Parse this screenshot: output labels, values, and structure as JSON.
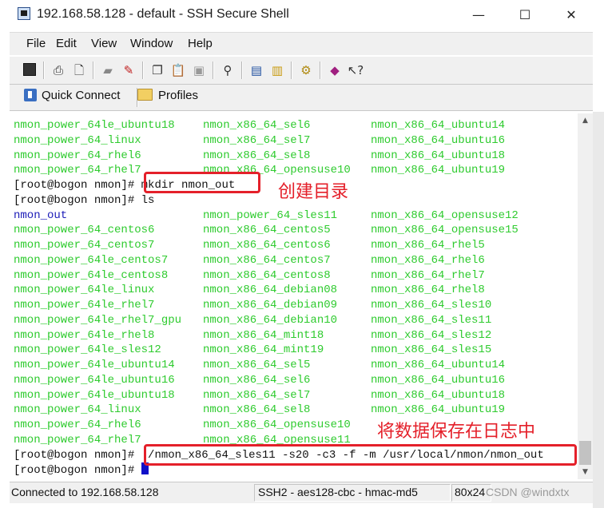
{
  "window": {
    "title": "192.168.58.128 - default - SSH Secure Shell",
    "minimize_icon": "minimize-icon",
    "maximize_icon": "maximize-icon",
    "close_icon": "close-icon"
  },
  "menu": [
    "File",
    "Edit",
    "View",
    "Window",
    "Help"
  ],
  "toolbar": {
    "icons": [
      "save-icon",
      "print-icon",
      "print-preview-icon",
      "copy-icon",
      "paste-icon",
      "paste-disabled-icon",
      "find-icon",
      "new-terminal-icon",
      "new-file-transfer-icon",
      "settings-icon",
      "help-topics-icon",
      "context-help-icon"
    ]
  },
  "toolbar2": {
    "quick_connect": "Quick Connect",
    "profiles": "Profiles"
  },
  "terminal": {
    "lines": [
      [
        "nmon_power_64le_ubuntu18",
        "nmon_x86_64_sel6",
        "nmon_x86_64_ubuntu14"
      ],
      [
        "nmon_power_64_linux",
        "nmon_x86_64_sel7",
        "nmon_x86_64_ubuntu16"
      ],
      [
        "nmon_power_64_rhel6",
        "nmon_x86_64_sel8",
        "nmon_x86_64_ubuntu18"
      ],
      [
        "nmon_power_64_rhel7",
        "nmon_x86_64_opensuse10",
        "nmon_x86_64_ubuntu19"
      ]
    ],
    "prompt": "[root@bogon nmon]# ",
    "cmd_mkdir": "mkdir nmon_out",
    "cmd_ls": "ls",
    "ls_rows": [
      [
        "nmon_out",
        "nmon_power_64_sles11",
        "nmon_x86_64_opensuse12"
      ],
      [
        "nmon_power_64_centos6",
        "nmon_x86_64_centos5",
        "nmon_x86_64_opensuse15"
      ],
      [
        "nmon_power_64_centos7",
        "nmon_x86_64_centos6",
        "nmon_x86_64_rhel5"
      ],
      [
        "nmon_power_64le_centos7",
        "nmon_x86_64_centos7",
        "nmon_x86_64_rhel6"
      ],
      [
        "nmon_power_64le_centos8",
        "nmon_x86_64_centos8",
        "nmon_x86_64_rhel7"
      ],
      [
        "nmon_power_64le_linux",
        "nmon_x86_64_debian08",
        "nmon_x86_64_rhel8"
      ],
      [
        "nmon_power_64le_rhel7",
        "nmon_x86_64_debian09",
        "nmon_x86_64_sles10"
      ],
      [
        "nmon_power_64le_rhel7_gpu",
        "nmon_x86_64_debian10",
        "nmon_x86_64_sles11"
      ],
      [
        "nmon_power_64le_rhel8",
        "nmon_x86_64_mint18",
        "nmon_x86_64_sles12"
      ],
      [
        "nmon_power_64le_sles12",
        "nmon_x86_64_mint19",
        "nmon_x86_64_sles15"
      ],
      [
        "nmon_power_64le_ubuntu14",
        "nmon_x86_64_sel5",
        "nmon_x86_64_ubuntu14"
      ],
      [
        "nmon_power_64le_ubuntu16",
        "nmon_x86_64_sel6",
        "nmon_x86_64_ubuntu16"
      ],
      [
        "nmon_power_64le_ubuntu18",
        "nmon_x86_64_sel7",
        "nmon_x86_64_ubuntu18"
      ],
      [
        "nmon_power_64_linux",
        "nmon_x86_64_sel8",
        "nmon_x86_64_ubuntu19"
      ],
      [
        "nmon_power_64_rhel6",
        "nmon_x86_64_opensuse10",
        ""
      ],
      [
        "nmon_power_64_rhel7",
        "nmon_x86_64_opensuse11",
        ""
      ]
    ],
    "cmd_run": "./nmon_x86_64_sles11 -s20 -c3 -f -m /usr/local/nmon/nmon_out",
    "colors": {
      "file_green": "#2ecb2e",
      "dir_blue": "#1c1cb8",
      "annotation_red": "#e4202a"
    }
  },
  "annotations": {
    "create_dir": "创建目录",
    "save_log": "将数据保存在日志中"
  },
  "status": {
    "connected": "Connected to 192.168.58.128",
    "cipher": "SSH2 - aes128-cbc - hmac-md5",
    "size": "80x24",
    "watermark": "CSDN @windxtx"
  }
}
